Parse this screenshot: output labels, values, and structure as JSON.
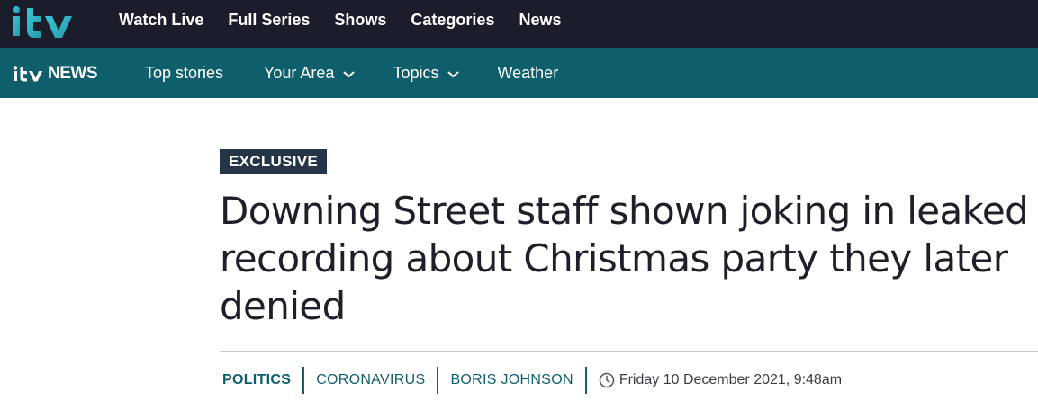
{
  "itv_header": {
    "logo_text": "itv",
    "nav": [
      "Watch Live",
      "Full Series",
      "Shows",
      "Categories",
      "News"
    ]
  },
  "news_header": {
    "logo_prefix": "itv",
    "logo_word": "NEWS",
    "nav": [
      {
        "label": "Top stories",
        "has_dropdown": false
      },
      {
        "label": "Your Area",
        "has_dropdown": true,
        "icon": "chevron-down-icon"
      },
      {
        "label": "Topics",
        "has_dropdown": true,
        "icon": "chevron-down-icon"
      },
      {
        "label": "Weather",
        "has_dropdown": false
      }
    ]
  },
  "article": {
    "badge": "EXCLUSIVE",
    "headline": "Downing Street staff shown joking in leaked recording about Christmas party they later denied",
    "tags": [
      "POLITICS",
      "CORONAVIRUS",
      "BORIS JOHNSON"
    ],
    "date_icon": "clock-icon",
    "date": "Friday 10 December 2021, 9:48am"
  },
  "colors": {
    "top_bar": "#1c1d2a",
    "news_bar": "#0f5e6b",
    "badge_bg": "#233546",
    "accent": "#0f5e6b",
    "logo_teal": "#2eb6c4"
  }
}
